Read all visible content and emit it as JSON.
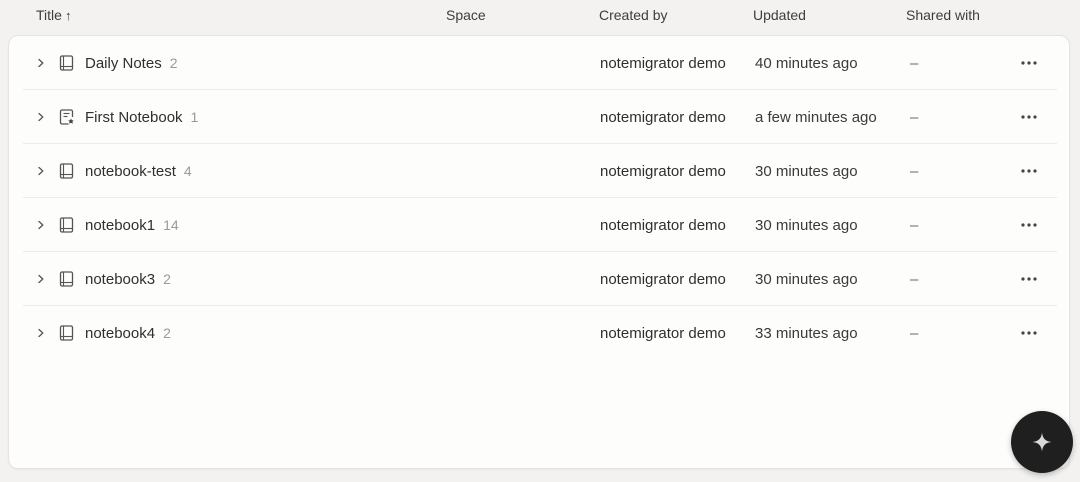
{
  "header": {
    "title": "Title",
    "sort_arrow": "↑",
    "space": "Space",
    "created_by": "Created by",
    "updated": "Updated",
    "shared_with": "Shared with"
  },
  "rows": [
    {
      "name": "Daily Notes",
      "count": "2",
      "created_by": "notemigrator demo",
      "updated": "40 minutes ago",
      "shared": "–",
      "icon": "notebook-icon"
    },
    {
      "name": "First Notebook",
      "count": "1",
      "created_by": "notemigrator demo",
      "updated": "a few minutes ago",
      "shared": "–",
      "icon": "default-notebook-icon"
    },
    {
      "name": "notebook-test",
      "count": "4",
      "created_by": "notemigrator demo",
      "updated": "30 minutes ago",
      "shared": "–",
      "icon": "notebook-icon"
    },
    {
      "name": "notebook1",
      "count": "14",
      "created_by": "notemigrator demo",
      "updated": "30 minutes ago",
      "shared": "–",
      "icon": "notebook-icon"
    },
    {
      "name": "notebook3",
      "count": "2",
      "created_by": "notemigrator demo",
      "updated": "30 minutes ago",
      "shared": "–",
      "icon": "notebook-icon"
    },
    {
      "name": "notebook4",
      "count": "2",
      "created_by": "notemigrator demo",
      "updated": "33 minutes ago",
      "shared": "–",
      "icon": "notebook-icon"
    }
  ],
  "fab": {
    "icon": "sparkle-icon"
  }
}
